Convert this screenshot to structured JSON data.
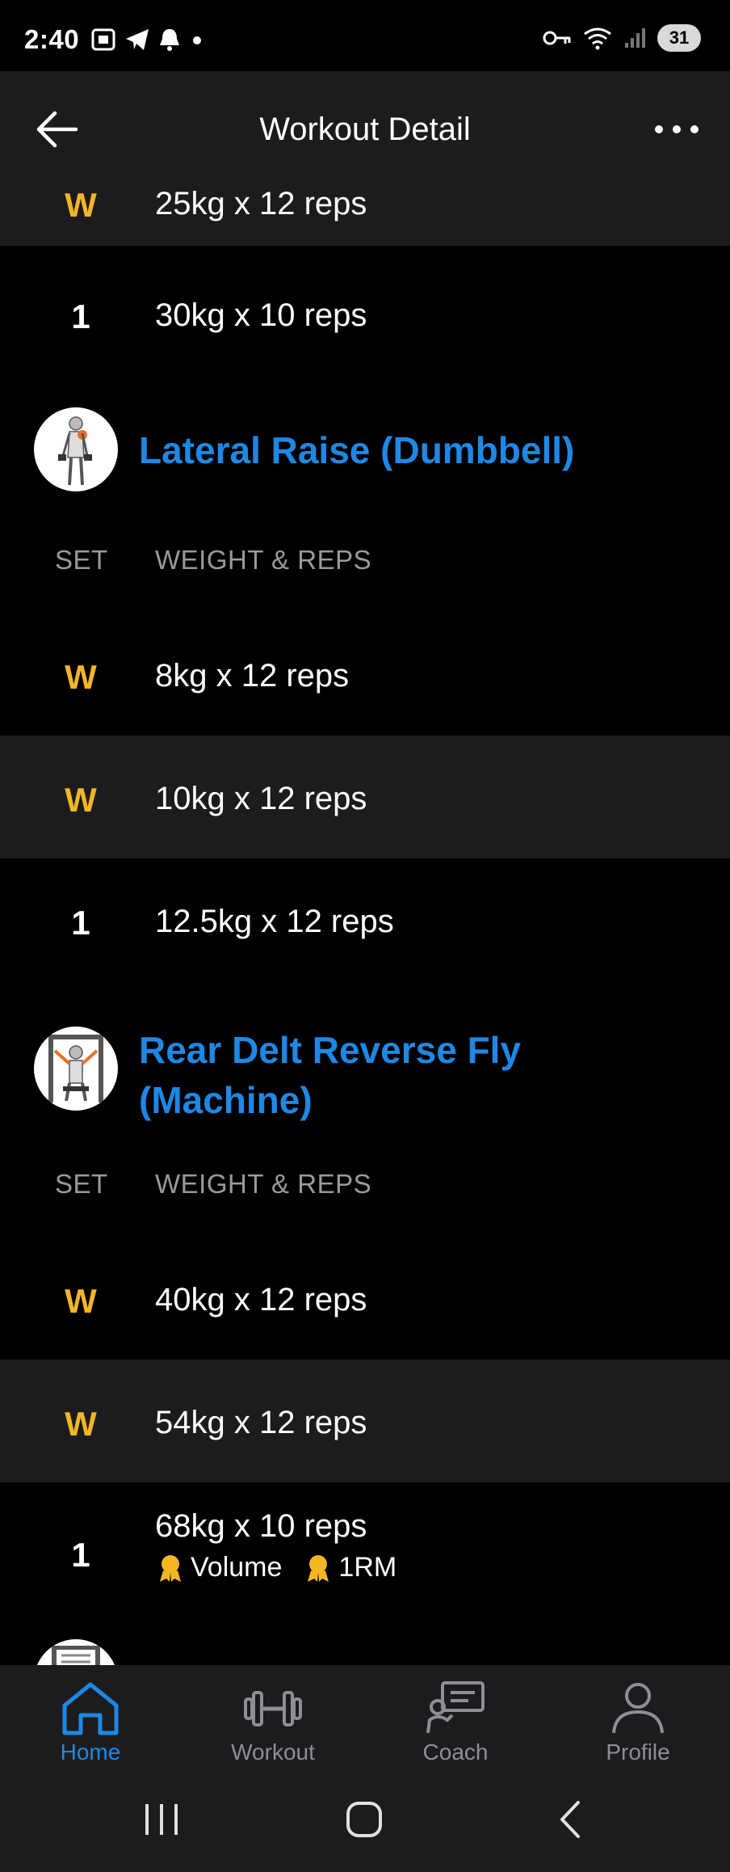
{
  "status_bar": {
    "time": "2:40",
    "battery": "31"
  },
  "header": {
    "title": "Workout Detail"
  },
  "exercises": [
    {
      "sets": [
        {
          "label": "W",
          "value": "25kg x 12 reps"
        },
        {
          "label": "1",
          "value": "30kg x 10 reps"
        }
      ]
    },
    {
      "name": "Lateral Raise (Dumbbell)",
      "col_set": "SET",
      "col_weight": "WEIGHT & REPS",
      "sets": [
        {
          "label": "W",
          "value": "8kg x 12 reps"
        },
        {
          "label": "W",
          "value": "10kg x 12 reps"
        },
        {
          "label": "1",
          "value": "12.5kg x 12 reps"
        }
      ]
    },
    {
      "name_line1": "Rear Delt Reverse Fly",
      "name_line2": "(Machine)",
      "col_set": "SET",
      "col_weight": "WEIGHT & REPS",
      "sets": [
        {
          "label": "W",
          "value": "40kg x 12 reps"
        },
        {
          "label": "W",
          "value": "54kg x 12 reps"
        },
        {
          "label": "1",
          "value": "68kg x 10 reps",
          "badges": [
            "Volume",
            "1RM"
          ]
        }
      ]
    }
  ],
  "bottom_nav": [
    {
      "label": "Home",
      "icon": "home-icon",
      "active": true
    },
    {
      "label": "Workout",
      "icon": "dumbbell-icon",
      "active": false
    },
    {
      "label": "Coach",
      "icon": "coach-icon",
      "active": false
    },
    {
      "label": "Profile",
      "icon": "profile-icon",
      "active": false
    }
  ],
  "colors": {
    "accent": "#1e88e5",
    "warmup": "#f5b624",
    "medal": "#f5b624",
    "row_alt": "#1c1c1e"
  }
}
